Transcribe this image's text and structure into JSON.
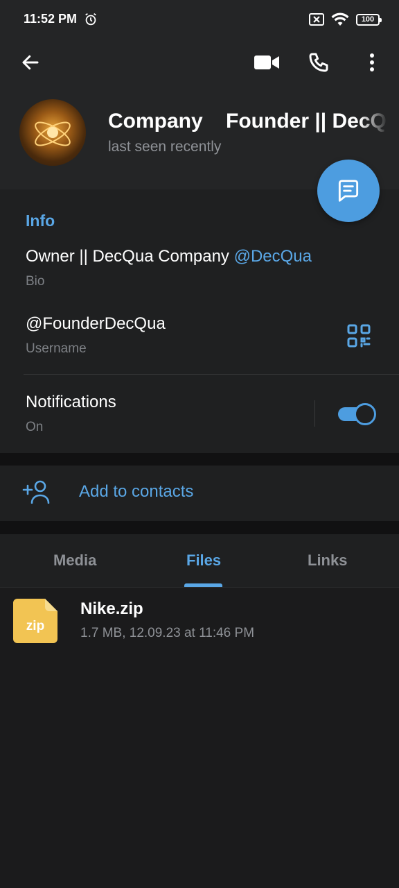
{
  "status_bar": {
    "time": "11:52 PM",
    "battery": "100",
    "icons": [
      "alarm-icon",
      "sim-x-icon",
      "wifi-icon",
      "battery-icon"
    ]
  },
  "top_bar": {
    "icons": [
      "back-arrow-icon",
      "video-call-icon",
      "phone-icon",
      "more-vertical-icon"
    ]
  },
  "profile": {
    "name": "Company    Founder || DecQu",
    "status": "last seen recently"
  },
  "info": {
    "title": "Info",
    "bio_text": "Owner || DecQua Company ",
    "bio_mention": "@DecQua",
    "bio_caption": "Bio",
    "username": "@FounderDecQua",
    "username_caption": "Username",
    "notifications_label": "Notifications",
    "notifications_state": "On",
    "notifications_enabled": true
  },
  "actions": {
    "add_contact": "Add to contacts"
  },
  "tabs": [
    {
      "label": "Media",
      "active": false
    },
    {
      "label": "Files",
      "active": true
    },
    {
      "label": "Links",
      "active": false
    }
  ],
  "files": [
    {
      "thumb_label": "zip",
      "name": "Nike.zip",
      "meta": "1.7 MB, 12.09.23 at 11:46 PM"
    }
  ],
  "colors": {
    "accent": "#5aa7e6",
    "fab": "#4d9de0",
    "file_icon": "#f2c453"
  }
}
